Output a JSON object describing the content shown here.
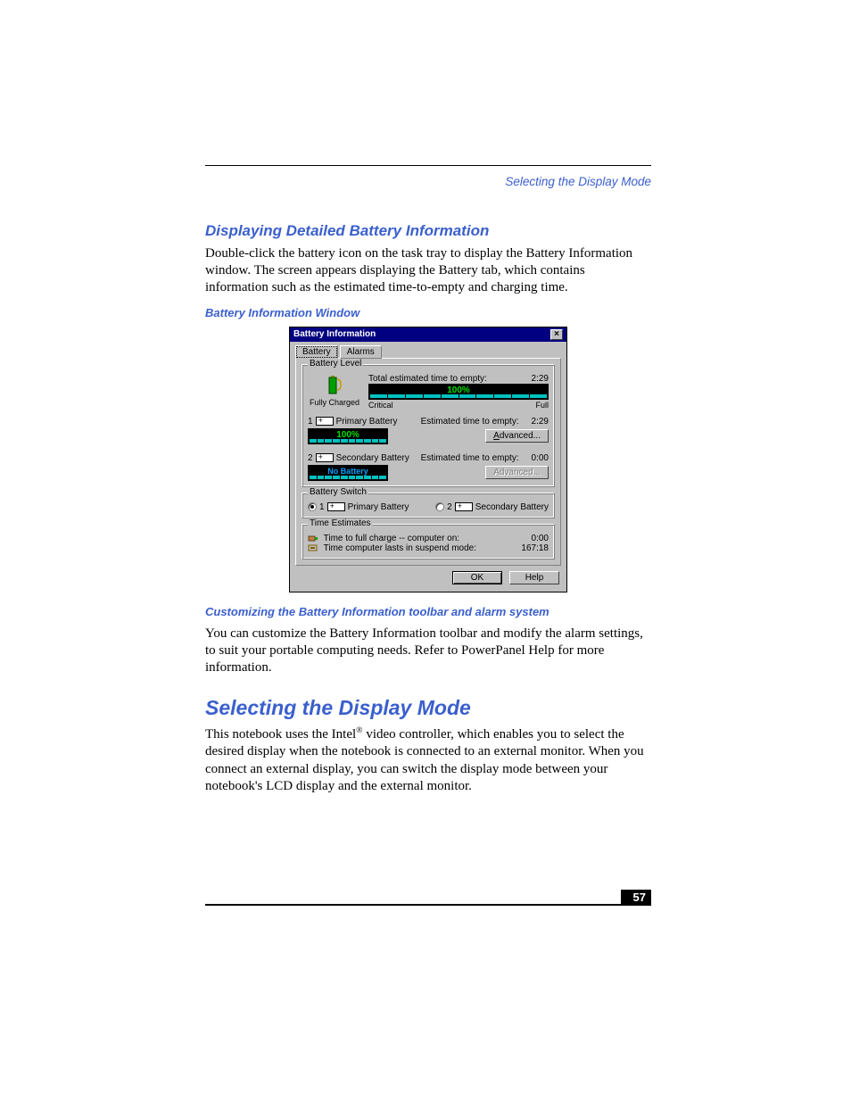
{
  "runningHeader": "Selecting the Display Mode",
  "section1": {
    "heading": "Displaying Detailed Battery Information",
    "para": "Double-click the battery icon on the task tray to display the Battery Information window. The screen appears displaying the Battery tab, which contains information such as the estimated time-to-empty and charging time.",
    "figCaption": "Battery Information Window"
  },
  "dialog": {
    "title": "Battery Information",
    "tabs": {
      "battery": "Battery",
      "alarms": "Alarms"
    },
    "level": {
      "group": "Battery Level",
      "status": "Fully Charged",
      "totalLabel": "Total estimated time to empty:",
      "totalValue": "2:29",
      "pct": "100%",
      "scaleLow": "Critical",
      "scaleHigh": "Full"
    },
    "primary": {
      "num": "1",
      "label": "Primary Battery",
      "estLabel": "Estimated time to empty:",
      "estValue": "2:29",
      "pct": "100%",
      "advanced": "Advanced..."
    },
    "secondary": {
      "num": "2",
      "label": "Secondary Battery",
      "estLabel": "Estimated time to empty:",
      "estValue": "0:00",
      "status": "No Battery",
      "advanced": "Advanced..."
    },
    "switch": {
      "group": "Battery Switch",
      "opt1": "Primary Battery",
      "opt2": "Secondary Battery",
      "n1": "1",
      "n2": "2"
    },
    "estimates": {
      "group": "Time Estimates",
      "row1Label": "Time to full charge -- computer on:",
      "row1Value": "0:00",
      "row2Label": "Time computer lasts in suspend mode:",
      "row2Value": "167:18"
    },
    "buttons": {
      "ok": "OK",
      "help": "Help"
    }
  },
  "section2": {
    "heading": "Customizing the Battery Information toolbar and alarm system",
    "para": "You can customize the Battery Information toolbar and modify the alarm settings, to suit your portable computing needs. Refer to PowerPanel Help for more information."
  },
  "section3": {
    "heading": "Selecting the Display Mode",
    "para1a": "This notebook uses the Intel",
    "reg": "®",
    "para1b": " video controller, which enables you to select the desired display when the notebook is connected to an external monitor. When you connect an external display, you can switch the display mode between your notebook's LCD display and the external monitor."
  },
  "pageNumber": "57"
}
